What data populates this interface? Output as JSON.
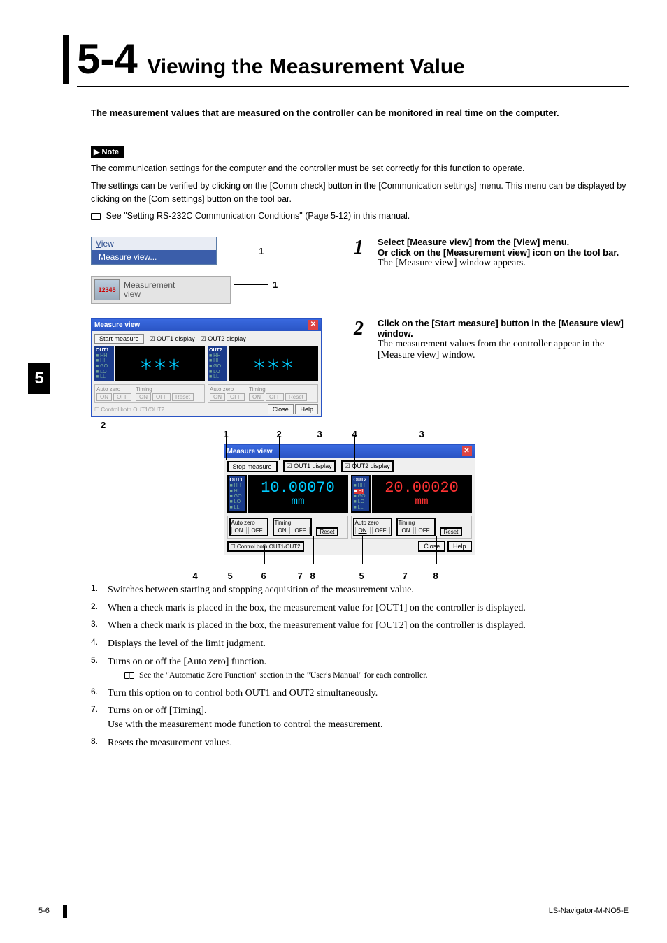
{
  "section": {
    "number": "5-4",
    "title": "Viewing the Measurement Value"
  },
  "intro": "The measurement values that are measured on the controller can be monitored in real time on the computer.",
  "note": {
    "label": "Note",
    "lines": [
      "The communication settings for the computer and the controller must be set correctly for this function to operate.",
      "The settings can be verified by clicking on the [Comm check] button in the [Communication settings] menu. This menu can be displayed by clicking on the [Com settings] button on the tool bar."
    ],
    "ref": "See \"Setting RS-232C Communication Conditions\" (Page 5-12) in this manual."
  },
  "step1": {
    "num": "1",
    "bold1": "Select [Measure view] from the [View] menu.",
    "bold2": "Or click on the [Measurement view] icon on the tool bar.",
    "reg": "The [Measure view] window appears.",
    "menu": {
      "title_pre": "V",
      "title_rest": "iew",
      "item": "Measure view...",
      "item_u": "v"
    },
    "toolbar": {
      "icon_text": "12345",
      "label": "Measurement\nview"
    },
    "callout": "1"
  },
  "step2": {
    "num": "2",
    "bold": "Click on the [Start measure] button in the [Measure view] window.",
    "reg": "The measurement values from the controller appear in the [Measure view] window.",
    "callout": "2",
    "window": {
      "title": "Measure view",
      "start_btn": "Start measure",
      "chk1": "OUT1 display",
      "chk2": "OUT2 display",
      "out1_label": "OUT1",
      "out2_label": "OUT2",
      "levels": [
        "HH",
        "HI",
        "GO",
        "LO",
        "LL"
      ],
      "placeholder": "＊＊＊",
      "auto_zero": "Auto zero",
      "timing": "Timing",
      "on": "ON",
      "off": "OFF",
      "reset": "Reset",
      "control_both": "Control both OUT1/OUT2",
      "close": "Close",
      "help": "Help"
    }
  },
  "detail": {
    "top_labels": {
      "1": "1",
      "2": "2",
      "3a": "3",
      "4": "4",
      "3b": "3"
    },
    "bottom_labels": {
      "4": "4",
      "5a": "5",
      "6": "6",
      "7a": "7",
      "8a": "8",
      "5b": "5",
      "7b": "7",
      "8b": "8"
    },
    "window": {
      "title": "Measure view",
      "stop_btn": "Stop measure",
      "chk1": "OUT1 display",
      "chk2": "OUT2 display",
      "out1_label": "OUT1",
      "out2_label": "OUT2",
      "levels": [
        "HH",
        "HI",
        "GO",
        "LO",
        "LL"
      ],
      "val1": "10.00070",
      "val2": "20.00020",
      "unit": "mm",
      "auto_zero": "Auto zero",
      "timing": "Timing",
      "on": "ON",
      "off": "OFF",
      "reset": "Reset",
      "control_both": "Control both OUT1/OUT2",
      "close": "Close",
      "help": "Help"
    }
  },
  "list": {
    "items": [
      {
        "n": "1.",
        "t": "Switches between starting and stopping acquisition of the measurement value."
      },
      {
        "n": "2.",
        "t": "When a check mark is placed in the box, the measurement value for [OUT1] on the controller is displayed."
      },
      {
        "n": "3.",
        "t": "When a check mark is placed in the box, the measurement value for [OUT2] on the controller is displayed."
      },
      {
        "n": "4.",
        "t": "Displays the level of the limit judgment."
      },
      {
        "n": "5.",
        "t": "Turns on or off the [Auto zero] function.",
        "sub": "See the \"Automatic Zero Function\" section in the \"User's Manual\" for each controller."
      },
      {
        "n": "6.",
        "t": "Turn this option on to control both OUT1 and OUT2 simultaneously."
      },
      {
        "n": "7.",
        "t": "Turns on or off [Timing].",
        "cont": "Use with the measurement mode function to control the measurement."
      },
      {
        "n": "8.",
        "t": "Resets the measurement values."
      }
    ]
  },
  "side_tab": "5",
  "footer": {
    "page": "5-6",
    "doc": "LS-Navigator-M-NO5-E"
  }
}
